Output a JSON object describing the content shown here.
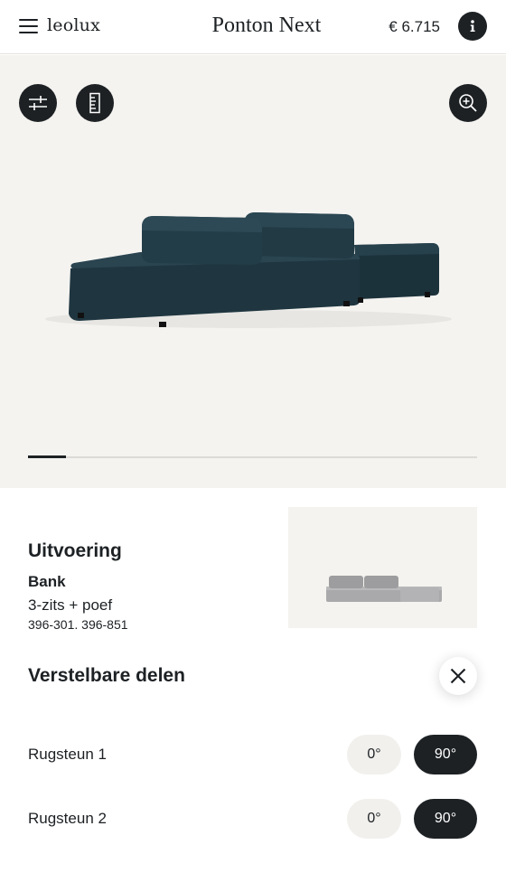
{
  "header": {
    "brand": "leolux",
    "title": "Ponton Next",
    "price": "€ 6.715"
  },
  "viewer": {
    "progress_fraction": 0.085
  },
  "colors": {
    "dark": "#1d2124",
    "viewer_bg": "#f4f3f0",
    "sofa": "#213a44",
    "thumb_sofa": "#a9a9ab"
  },
  "icons": {
    "menu": "hamburger-icon",
    "info": "info-icon",
    "filters": "sliders-icon",
    "dimensions": "ruler-icon",
    "zoom": "zoom-in-icon",
    "close": "close-icon"
  },
  "details": {
    "heading": "Uitvoering",
    "type": "Bank",
    "config": "3-zits + poef",
    "article_numbers": "396-301. 396-851"
  },
  "adjustable": {
    "heading": "Verstelbare delen",
    "rows": [
      {
        "label": "Rugsteun 1",
        "options": [
          "0°",
          "90°"
        ],
        "selected": "90°"
      },
      {
        "label": "Rugsteun 2",
        "options": [
          "0°",
          "90°"
        ],
        "selected": "90°"
      }
    ]
  }
}
